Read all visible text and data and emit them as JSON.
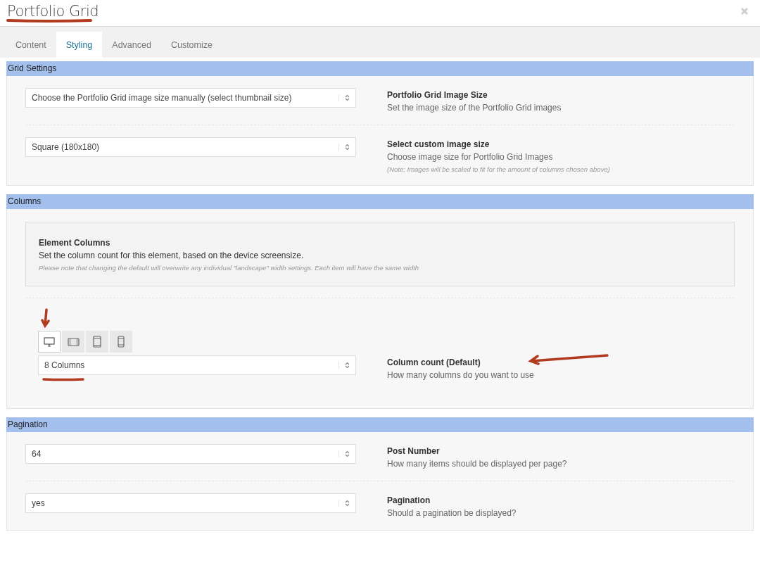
{
  "window": {
    "title": "Portfolio Grid"
  },
  "tabs": [
    {
      "label": "Content",
      "selected": false
    },
    {
      "label": "Styling",
      "selected": true
    },
    {
      "label": "Advanced",
      "selected": false
    },
    {
      "label": "Customize",
      "selected": false
    }
  ],
  "sections": [
    {
      "title": "Grid Settings",
      "rows": [
        {
          "value": "Choose the Portfolio Grid image size manually (select thumbnail size)",
          "label": "Portfolio Grid Image Size",
          "description": "Set the image size of the Portfolio Grid images"
        },
        {
          "value": "Square (180x180)",
          "label": "Select custom image size",
          "description": "Choose image size for Portfolio Grid Images",
          "note": "(Note: Images will be scaled to fit for the amount of columns chosen above)"
        }
      ]
    },
    {
      "title": "Columns",
      "info": {
        "title": "Element Columns",
        "description": "Set the column count for this element, based on the device screensize.",
        "note": "Please note that changing the default will overwrite any individual \"landscape\" width settings. Each item will have the same width"
      },
      "rows": [
        {
          "devices": [
            {
              "kind": "desktop",
              "selected": true
            },
            {
              "kind": "landscape",
              "selected": false
            },
            {
              "kind": "tablet",
              "selected": false
            },
            {
              "kind": "phone",
              "selected": false
            }
          ],
          "value": "8 Columns",
          "label": "Column count (Default)",
          "description": "How many columns do you want to use"
        }
      ]
    },
    {
      "title": "Pagination",
      "rows": [
        {
          "value": "64",
          "label": "Post Number",
          "description": "How many items should be displayed per page?"
        },
        {
          "value": "yes",
          "label": "Pagination",
          "description": "Should a pagination be displayed?"
        }
      ]
    }
  ]
}
